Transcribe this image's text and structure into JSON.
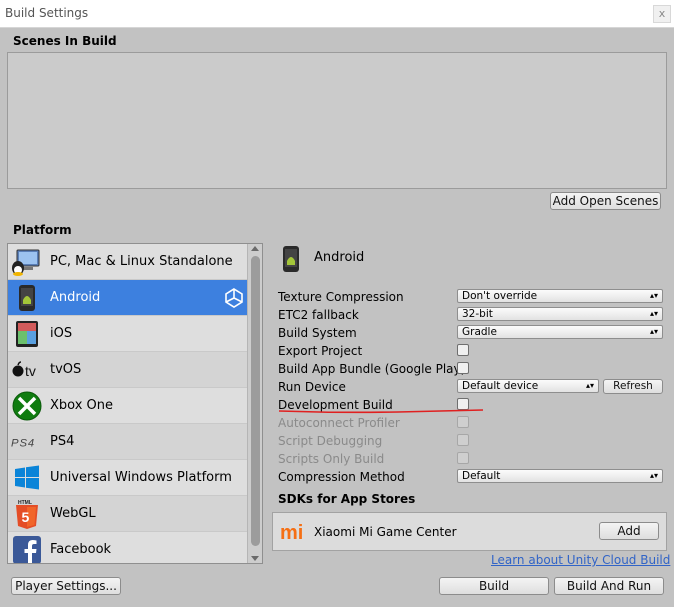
{
  "window": {
    "title": "Build Settings",
    "close": "x"
  },
  "scenes": {
    "heading": "Scenes In Build",
    "add_open_scenes": "Add Open Scenes"
  },
  "platform": {
    "heading": "Platform",
    "items": [
      {
        "label": "PC, Mac & Linux Standalone",
        "icon": "pc-mac-linux-icon"
      },
      {
        "label": "Android",
        "icon": "android-icon"
      },
      {
        "label": "iOS",
        "icon": "ios-icon"
      },
      {
        "label": "tvOS",
        "icon": "tvos-icon"
      },
      {
        "label": "Xbox One",
        "icon": "xbox-icon"
      },
      {
        "label": "PS4",
        "icon": "ps4-icon"
      },
      {
        "label": "Universal Windows Platform",
        "icon": "windows-icon"
      },
      {
        "label": "WebGL",
        "icon": "html5-icon"
      },
      {
        "label": "Facebook",
        "icon": "facebook-icon"
      }
    ],
    "selected": "Android"
  },
  "settings": {
    "platform_title": "Android",
    "texture_compression": {
      "label": "Texture Compression",
      "value": "Don't override"
    },
    "etc2_fallback": {
      "label": "ETC2 fallback",
      "value": "32-bit"
    },
    "build_system": {
      "label": "Build System",
      "value": "Gradle"
    },
    "export_project": {
      "label": "Export Project"
    },
    "build_app_bundle": {
      "label": "Build App Bundle (Google Play)"
    },
    "run_device": {
      "label": "Run Device",
      "value": "Default device",
      "refresh": "Refresh"
    },
    "development_build": {
      "label": "Development Build"
    },
    "autoconnect_profiler": {
      "label": "Autoconnect Profiler"
    },
    "script_debugging": {
      "label": "Script Debugging"
    },
    "scripts_only_build": {
      "label": "Scripts Only Build"
    },
    "compression_method": {
      "label": "Compression Method",
      "value": "Default"
    }
  },
  "sdks": {
    "heading": "SDKs for App Stores",
    "item": {
      "name": "Xiaomi Mi Game Center",
      "add": "Add",
      "logo_text": "mi"
    },
    "cloud_link": "Learn about Unity Cloud Build"
  },
  "footer": {
    "player_settings": "Player Settings...",
    "build": "Build",
    "build_and_run": "Build And Run"
  },
  "colors": {
    "selection": "#3d80df",
    "annotation": "#e02020",
    "link": "#3164c7"
  }
}
